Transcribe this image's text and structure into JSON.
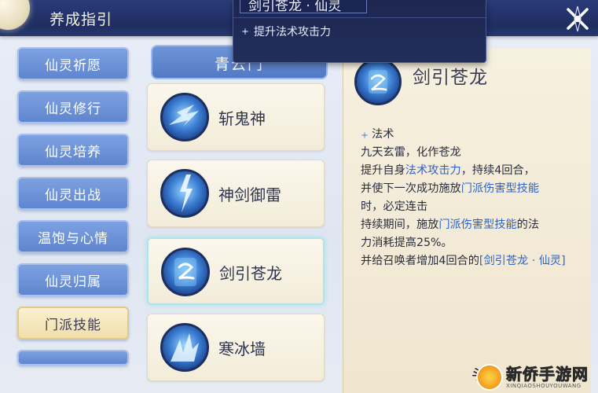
{
  "header": {
    "title": "养成指引"
  },
  "tooltip": {
    "title": "剑引苍龙 · 仙灵",
    "item": "提升法术攻击力"
  },
  "sidebar": {
    "items": [
      {
        "label": "仙灵祈愿",
        "active": false
      },
      {
        "label": "仙灵修行",
        "active": false
      },
      {
        "label": "仙灵培养",
        "active": false
      },
      {
        "label": "仙灵出战",
        "active": false
      },
      {
        "label": "温饱与心情",
        "active": false
      },
      {
        "label": "仙灵归属",
        "active": false
      },
      {
        "label": "门派技能",
        "active": true
      },
      {
        "label": "",
        "active": false
      }
    ]
  },
  "skills": {
    "tab_header": "青云门",
    "items": [
      {
        "name": "斩鬼神",
        "selected": false
      },
      {
        "name": "神剑御雷",
        "selected": false
      },
      {
        "name": "剑引苍龙",
        "selected": true
      },
      {
        "name": "寒冰墙",
        "selected": false
      }
    ]
  },
  "detail": {
    "name": "剑引苍龙",
    "section": "法术",
    "line1": "九天玄雷，化作苍龙",
    "line2_a": "提升自身",
    "line2_hl": "法术攻击力",
    "line2_b": "，持续4回合，",
    "line3_a": "并使下一次成功施放",
    "line3_hl": "门派伤害型技能",
    "line4": "时，必定连击",
    "line5_a": "持续期间，施放",
    "line5_hl": "门派伤害型技能",
    "line5_b": "的法",
    "line6": "力消耗提高25%。",
    "line7_a": "并给召唤者增加4回合的",
    "line7_hl": "[剑引苍龙 · 仙灵]"
  },
  "colors": {
    "header_bg": "#1f2d61",
    "sidebar_btn": "#6b90d6",
    "sidebar_active": "#f3e3b5",
    "highlight_text": "#2f63c9"
  },
  "watermark": {
    "text": "新侨手游网",
    "sub": "XINQIAOSHOUYOUWANG"
  },
  "cut_text": "头"
}
